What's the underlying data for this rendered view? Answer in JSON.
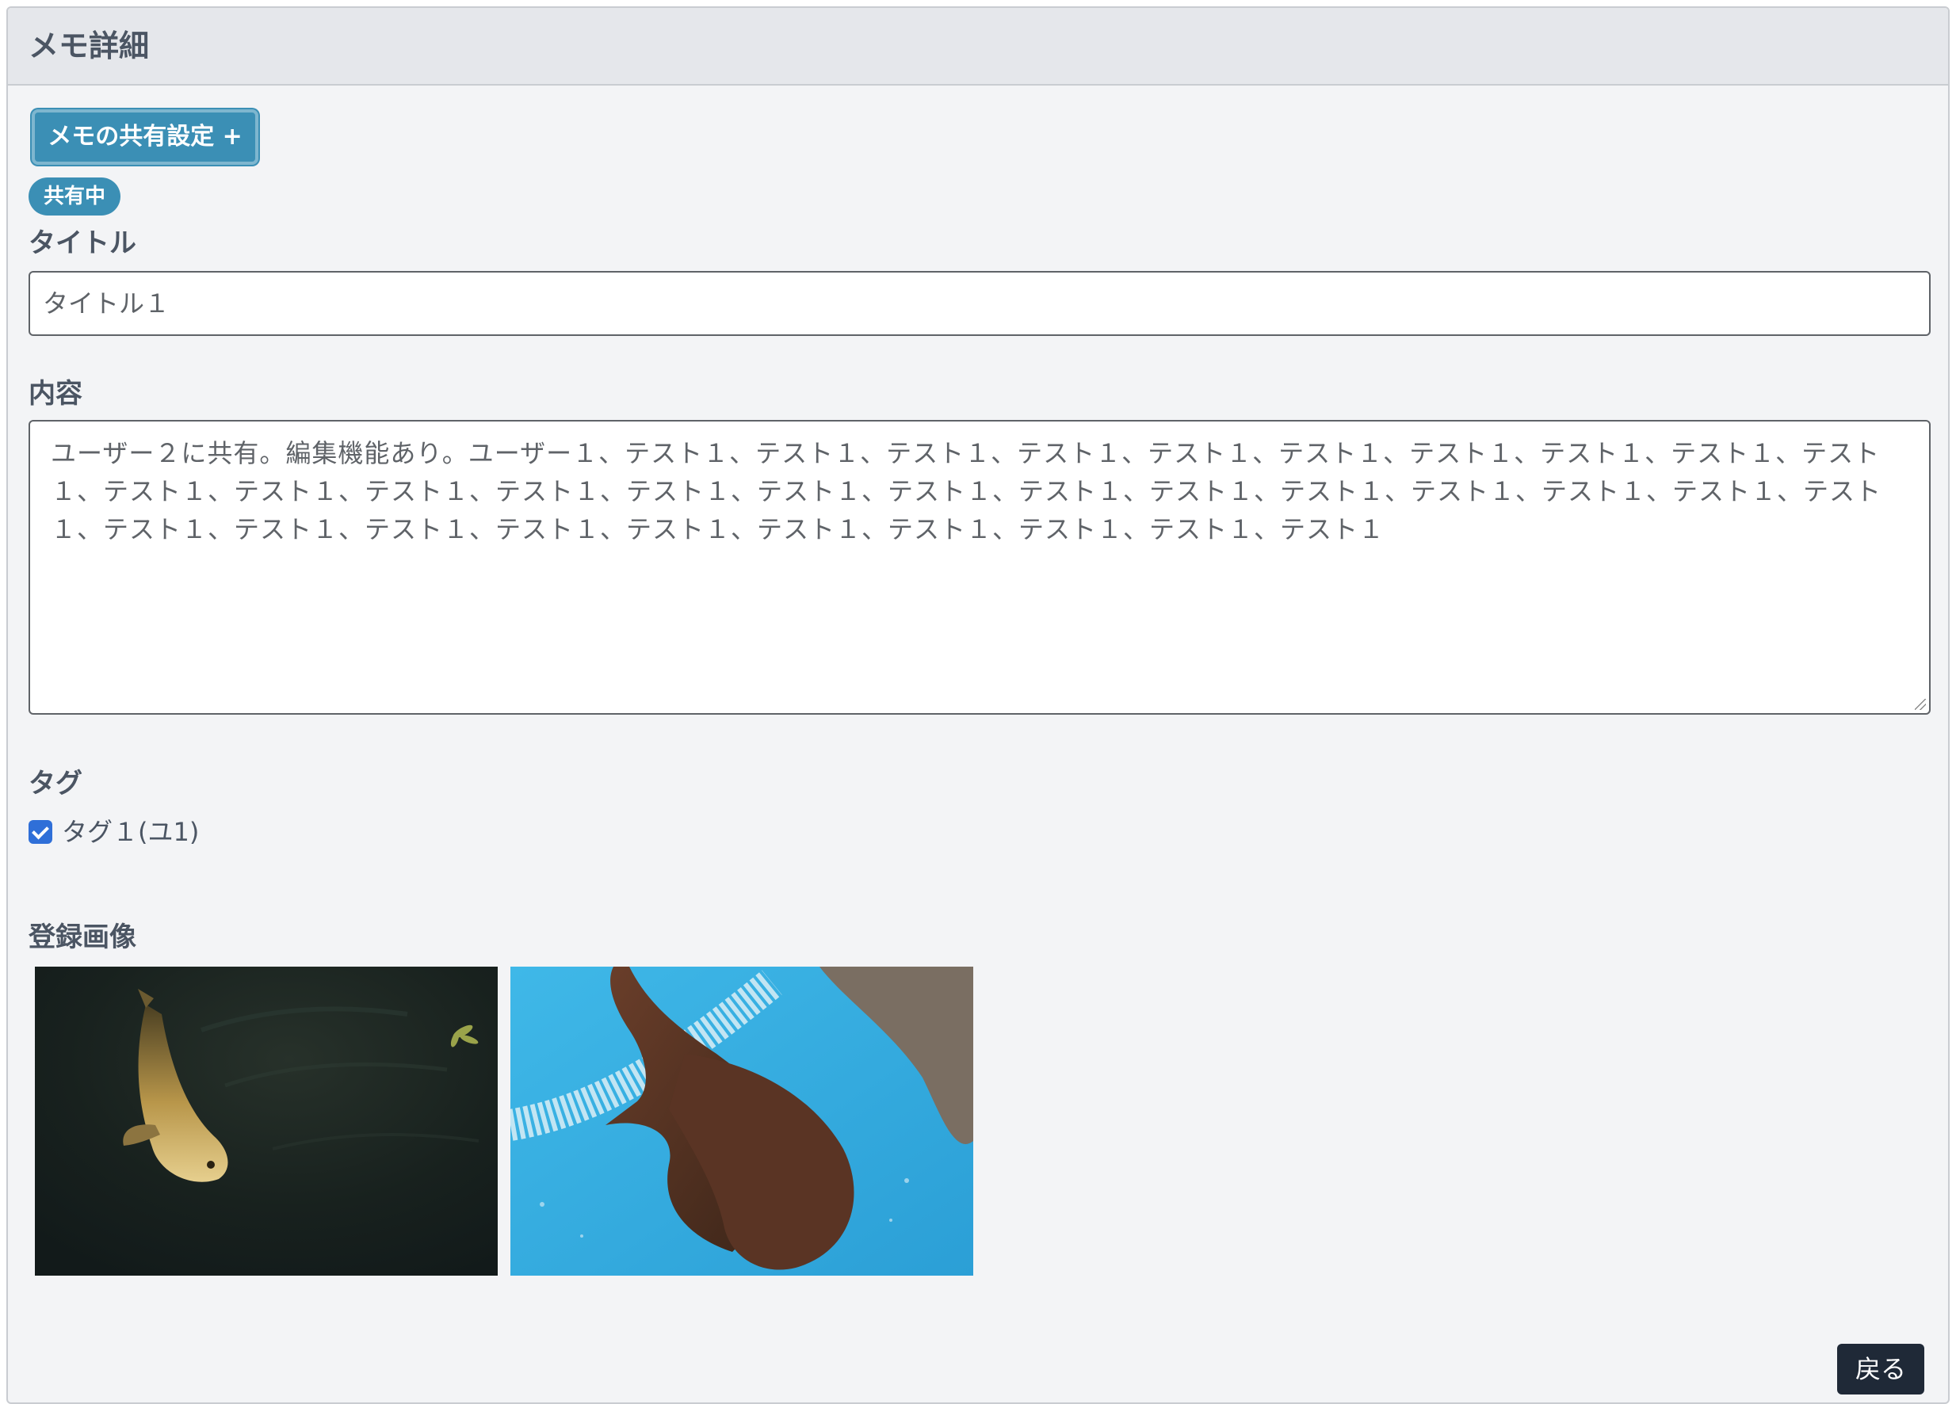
{
  "header": {
    "title": "メモ詳細"
  },
  "share": {
    "button_label": "メモの共有設定 +",
    "status_badge": "共有中"
  },
  "form": {
    "title_label": "タイトル",
    "title_value": "タイトル１",
    "content_label": "内容",
    "content_value": "ユーザー２に共有。編集機能あり。ユーザー１、テスト１、テスト１、テスト１、テスト１、テスト１、テスト１、テスト１、テスト１、テスト１、テスト１、テスト１、テスト１、テスト１、テスト１、テスト１、テスト１、テスト１、テスト１、テスト１、テスト１、テスト１、テスト１、テスト１、テスト１、テスト１、テスト１、テスト１、テスト１、テスト１、テスト１、テスト１、テスト１、テスト１、テスト１",
    "tags_label": "タグ",
    "tags": [
      {
        "label": "タグ１(ユ1)",
        "checked": true
      }
    ],
    "images_label": "登録画像",
    "images": [
      {
        "icon": "koi-fish-photo"
      },
      {
        "icon": "salamander-photo"
      }
    ]
  },
  "footer": {
    "back_label": "戻る"
  },
  "colors": {
    "accent": "#3b8fb5",
    "checkbox": "#2f6fd8",
    "back_button": "#1f2937",
    "card_bg": "#f3f4f6",
    "header_bg": "#e5e7eb"
  }
}
